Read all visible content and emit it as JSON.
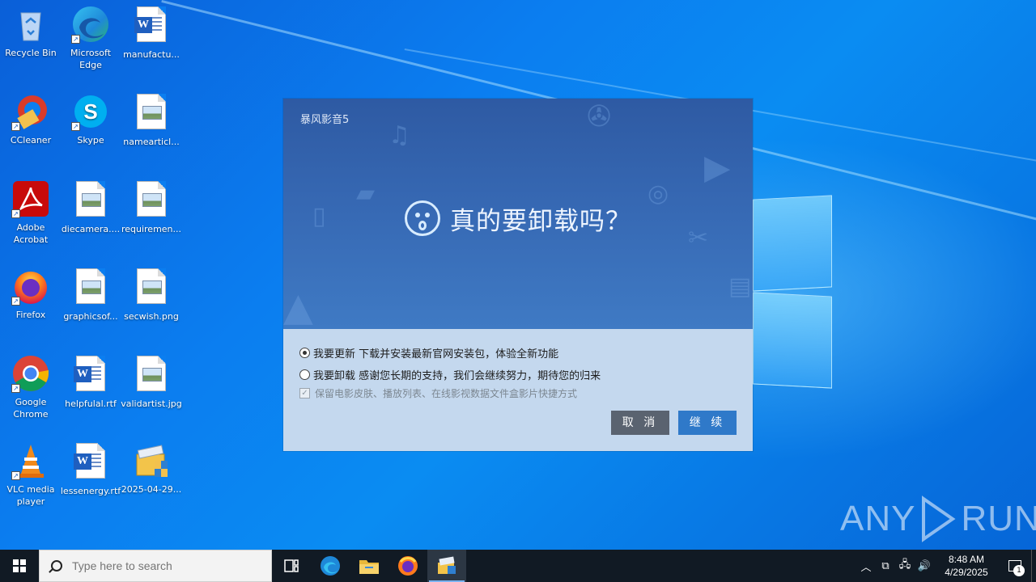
{
  "desktop": {
    "icons": [
      {
        "label": "Recycle Bin",
        "icon": "recycle-bin-icon"
      },
      {
        "label": "Microsoft Edge",
        "icon": "edge-icon"
      },
      {
        "label": "manufactu...",
        "icon": "word-doc-icon"
      },
      {
        "label": "CCleaner",
        "icon": "ccleaner-icon"
      },
      {
        "label": "Skype",
        "icon": "skype-icon"
      },
      {
        "label": "namearticl...",
        "icon": "image-file-icon"
      },
      {
        "label": "Adobe Acrobat",
        "icon": "acrobat-icon"
      },
      {
        "label": "diecamera....",
        "icon": "image-file-icon"
      },
      {
        "label": "requiremen...",
        "icon": "image-file-icon"
      },
      {
        "label": "Firefox",
        "icon": "firefox-icon"
      },
      {
        "label": "graphicsof...",
        "icon": "image-file-icon"
      },
      {
        "label": "secwish.png",
        "icon": "image-file-icon"
      },
      {
        "label": "Google Chrome",
        "icon": "chrome-icon"
      },
      {
        "label": "helpfulal.rtf",
        "icon": "word-doc-icon"
      },
      {
        "label": "validartist.jpg",
        "icon": "image-file-icon"
      },
      {
        "label": "VLC media player",
        "icon": "vlc-icon"
      },
      {
        "label": "lessenergy.rtf",
        "icon": "word-doc-icon"
      },
      {
        "label": "2025-04-29...",
        "icon": "installer-icon"
      }
    ]
  },
  "dialog": {
    "title": "暴风影音5",
    "headline": "真的要卸载吗？",
    "options": [
      {
        "label": "我要更新 下载并安装最新官网安装包，体验全新功能",
        "selected": true
      },
      {
        "label": "我要卸载 感谢您长期的支持，我们会继续努力，期待您的归来",
        "selected": false
      }
    ],
    "checkbox_label": "保留电影皮肤、播放列表、在线影视数据文件盒影片快捷方式",
    "cancel_label": "取 消",
    "continue_label": "继 续",
    "colors": {
      "top": "#3668b3",
      "bottom": "#c4d8ee",
      "cancel": "#5a6370",
      "continue": "#2f79c9"
    }
  },
  "watermark": {
    "left": "ANY",
    "right": "RUN"
  },
  "taskbar": {
    "search_placeholder": "Type here to search",
    "apps": [
      "task-view-icon",
      "edge-icon",
      "file-explorer-icon",
      "firefox-icon",
      "baofeng-installer-icon"
    ],
    "clock_time": "8:48 AM",
    "clock_date": "4/29/2025",
    "notification_count": "1"
  }
}
